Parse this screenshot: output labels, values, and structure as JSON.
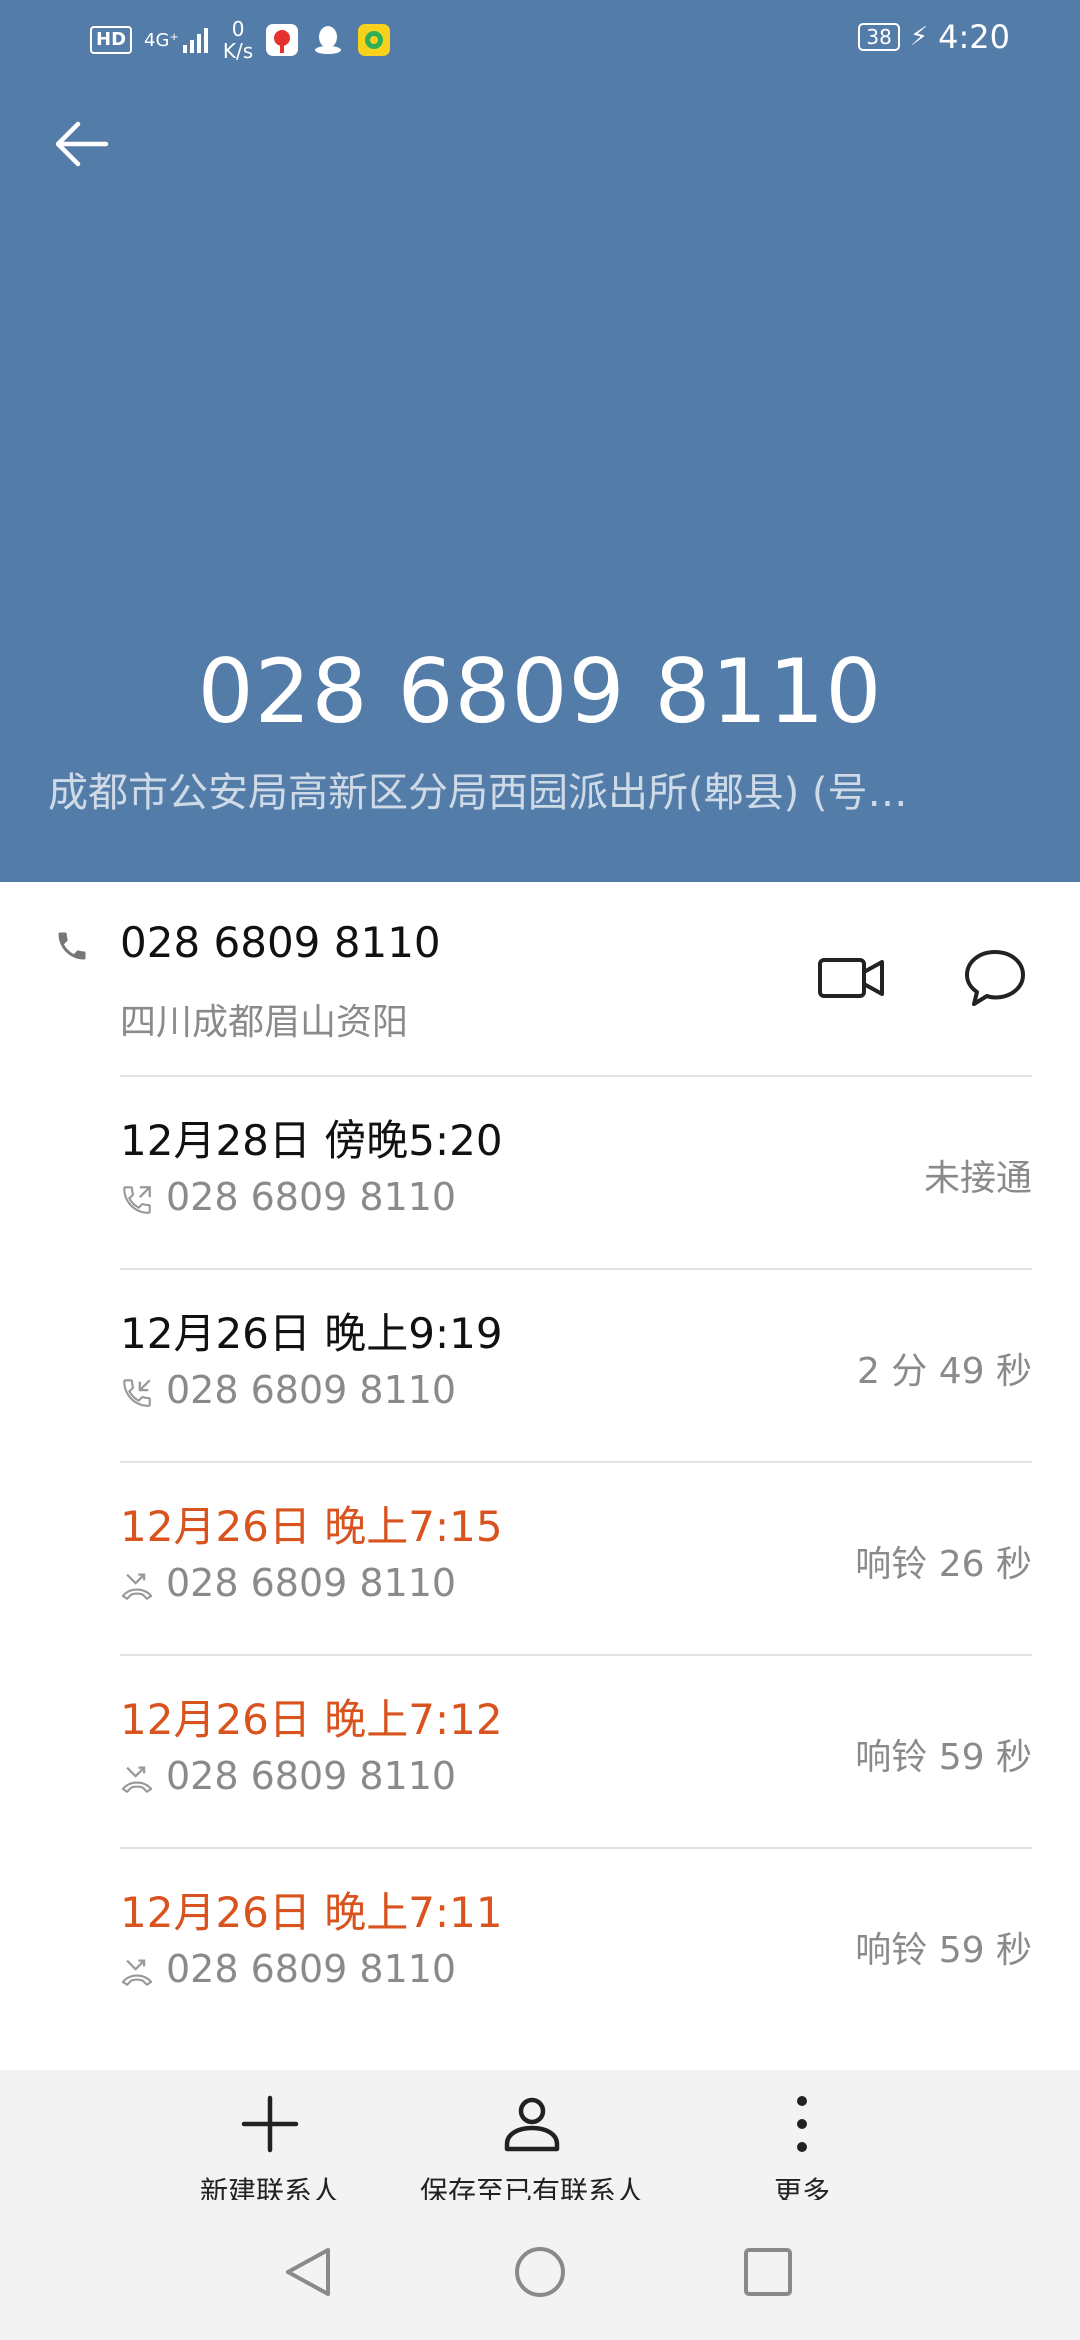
{
  "status_bar": {
    "hd": "HD",
    "network": "4G⁺",
    "speed_value": "0",
    "speed_unit": "K/s",
    "battery": "38",
    "time": "4:20"
  },
  "header": {
    "number": "028 6809 8110",
    "location": "成都市公安局高新区分局西园派出所(郫县) (号…"
  },
  "primary": {
    "number": "028 6809 8110",
    "location": "四川成都眉山资阳"
  },
  "call_log": [
    {
      "date": "12月28日 傍晚5:20",
      "number": "028 6809 8110",
      "status": "未接通",
      "type": "outgoing",
      "missed": false
    },
    {
      "date": "12月26日 晚上9:19",
      "number": "028 6809 8110",
      "status": "2 分 49 秒",
      "type": "incoming",
      "missed": false
    },
    {
      "date": "12月26日 晚上7:15",
      "number": "028 6809 8110",
      "status": "响铃 26 秒",
      "type": "missed",
      "missed": true
    },
    {
      "date": "12月26日 晚上7:12",
      "number": "028 6809 8110",
      "status": "响铃 59 秒",
      "type": "missed",
      "missed": true
    },
    {
      "date": "12月26日 晚上7:11",
      "number": "028 6809 8110",
      "status": "响铃 59 秒",
      "type": "missed",
      "missed": true
    }
  ],
  "actions": {
    "new_contact": "新建联系人",
    "save_existing": "保存至已有联系人",
    "more": "更多"
  },
  "colors": {
    "header_bg": "#537ca9",
    "missed": "#d9531e"
  }
}
